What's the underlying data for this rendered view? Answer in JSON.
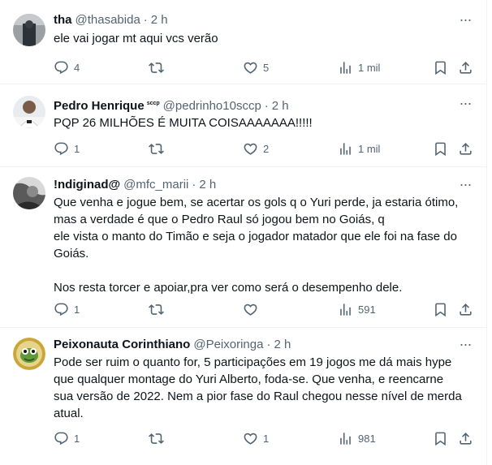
{
  "tweets": [
    {
      "name": "tha",
      "badge": "",
      "handle": "@thasabida",
      "dot": "·",
      "time": "2 h",
      "text": "ele vai jogar mt aqui vcs verão",
      "replies": "4",
      "retweets": "",
      "likes": "5",
      "views": "1 mil"
    },
    {
      "name": "Pedro Henrique",
      "badge": "sccp",
      "handle": "@pedrinho10sccp",
      "dot": "·",
      "time": "2 h",
      "text": "PQP 26 MILHÕES É MUITA COISAAAAAAA!!!!!",
      "replies": "1",
      "retweets": "",
      "likes": "2",
      "views": "1 mil"
    },
    {
      "name": "!ndiginad@",
      "badge": "",
      "handle": "@mfc_marii",
      "dot": "·",
      "time": "2 h",
      "text": "Que venha e jogue bem, se acertar os gols q o Yuri perde, ja estaria ótimo,\nmas a verdade é que o Pedro Raul só jogou bem no Goiás, q\nele vista o manto do Timão e seja o jogador matador que ele foi na fase do\nGoiás.\n\nNos resta torcer e apoiar,pra ver como será o desempenho dele.",
      "replies": "1",
      "retweets": "",
      "likes": "",
      "views": "591"
    },
    {
      "name": "Peixonauta Corinthiano",
      "badge": "",
      "handle": "@Peixoringa",
      "dot": "·",
      "time": "2 h",
      "text": "Pode ser ruim o quanto for, 5 participações em 19 jogos me dá mais hype\nque qualquer montage do Yuri Alberto, foda-se. Que venha, e reencarne\nsua versão de 2022. Nem a pior fase do Raul chegou nesse nível de merda\natual.",
      "replies": "1",
      "retweets": "",
      "likes": "1",
      "views": "981"
    }
  ],
  "icons": {
    "more": "more-icon",
    "reply": "reply-icon",
    "retweet": "retweet-icon",
    "like": "heart-icon",
    "views": "views-icon",
    "bookmark": "bookmark-icon",
    "share": "share-icon"
  },
  "colors": {
    "text": "#0f1419",
    "secondary": "#536471",
    "divider": "#eff3f4"
  }
}
